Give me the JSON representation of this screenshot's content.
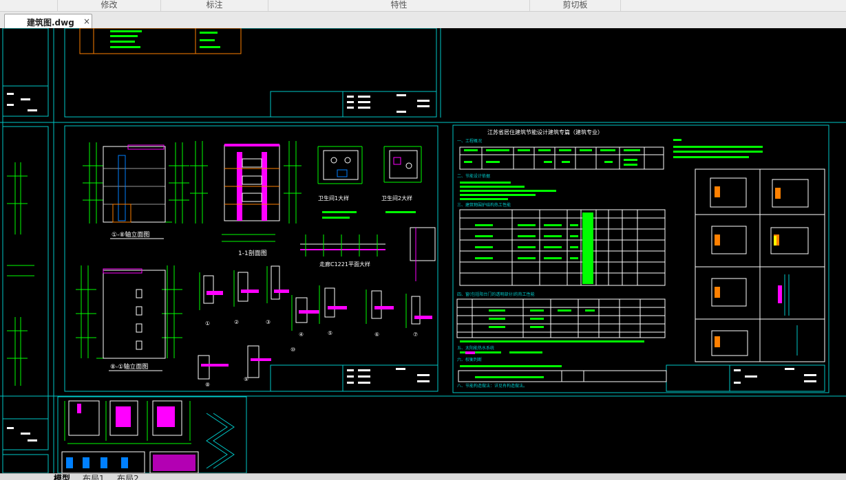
{
  "ribbon": {
    "sections": [
      {
        "label": "修改"
      },
      {
        "label": "标注"
      },
      {
        "label": "特性"
      },
      {
        "label": "剪切板"
      }
    ]
  },
  "document": {
    "tab_label": "建筑图.dwg",
    "close_glyph": "×"
  },
  "drawing": {
    "elevation_label_1": "①-⑧轴立面图",
    "elevation_label_2": "⑧-①轴立面图",
    "section_label": "1-1剖面图",
    "toilet_1": "卫生间1大样",
    "toilet_2": "卫生间2大样",
    "corridor_plan": "走廊C1221平面大样",
    "energy_title": "江苏省居住建筑节能设计建筑专篇（建筑专业）",
    "energy_sections": [
      "一、工程概况",
      "二、节能设计依据",
      "三、建筑物围护结构热工性能",
      "四、窗(包括阳台门的透明部分)的热工性能",
      "五、太阳能热水系统",
      "六、权衡判断",
      "八、节能构造做法：详见有构造做法。"
    ],
    "detail_marks": [
      "①",
      "②",
      "③",
      "④",
      "⑤",
      "⑥",
      "⑦",
      "⑧",
      "⑨",
      "⑩"
    ],
    "colors": {
      "border": "#00c8c8",
      "dimension": "#00ff00",
      "wall": "#ffffff",
      "accent": "#ff00ff",
      "glazing": "#0080ff",
      "cut": "#ff8000"
    }
  },
  "layouts": {
    "tabs": [
      {
        "label": "模型",
        "active": true
      },
      {
        "label": "布局1",
        "active": false
      },
      {
        "label": "布局2",
        "active": false
      }
    ]
  }
}
